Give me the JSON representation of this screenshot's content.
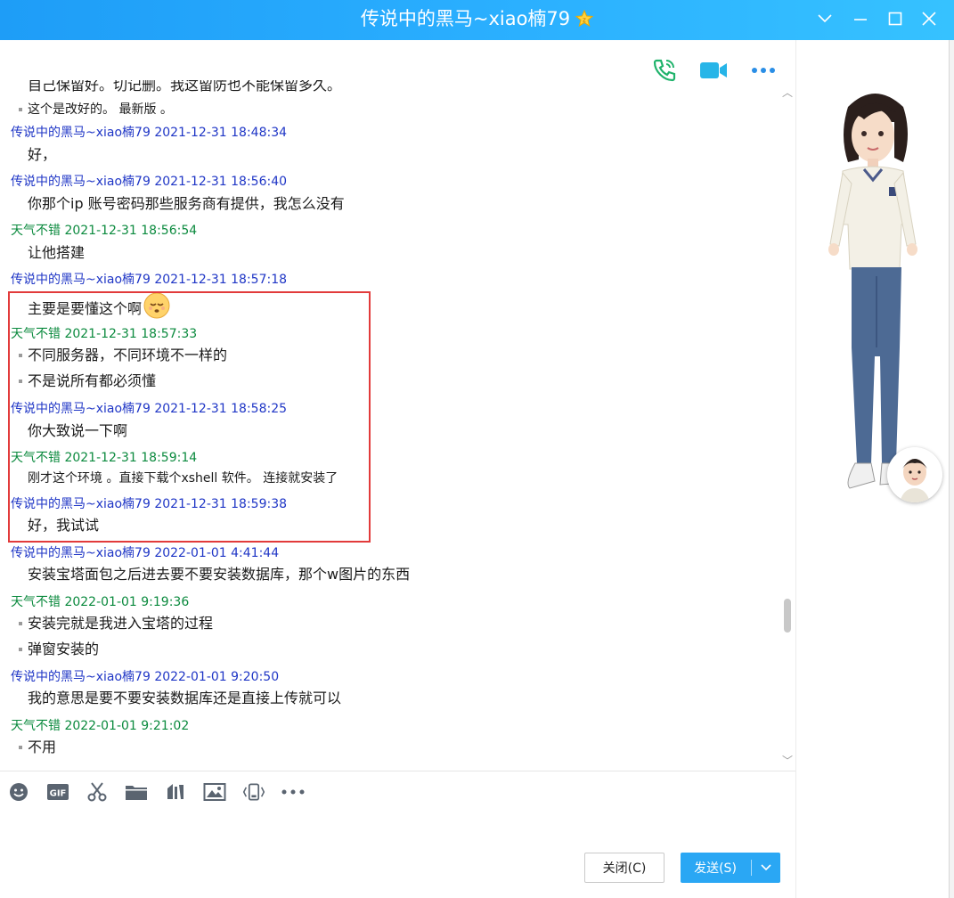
{
  "window": {
    "title": "传说中的黑马~xiao楠79",
    "controls": [
      "minimize-to-tray",
      "minimize",
      "maximize",
      "close"
    ]
  },
  "chat_header_icons": [
    "phone-icon",
    "video-call-icon",
    "more-icon"
  ],
  "messages": [
    {
      "type": "content",
      "text": "自己保留好。切记删。我这留防也不能保留多久。",
      "partial": true
    },
    {
      "type": "content",
      "text": "这个是改好的。 最新版 。",
      "bullet": true,
      "small": true
    },
    {
      "type": "sender",
      "who": "传说中的黑马~xiao楠79",
      "time": "2021-12-31 18:48:34",
      "color": "blue"
    },
    {
      "type": "content",
      "text": "好，"
    },
    {
      "type": "sender",
      "who": "传说中的黑马~xiao楠79",
      "time": "2021-12-31 18:56:40",
      "color": "blue"
    },
    {
      "type": "content",
      "text": "你那个ip 账号密码那些服务商有提供，我怎么没有"
    },
    {
      "type": "sender",
      "who": "天气不错",
      "time": "2021-12-31 18:56:54",
      "color": "green"
    },
    {
      "type": "content",
      "text": "让他搭建"
    },
    {
      "type": "sender",
      "who": "传说中的黑马~xiao楠79",
      "time": "2021-12-31 18:57:18",
      "color": "blue"
    },
    {
      "type": "content",
      "text": "主要是要懂这个啊",
      "emoji": "sigh-face"
    },
    {
      "type": "sender",
      "who": "天气不错",
      "time": "2021-12-31 18:57:33",
      "color": "green"
    },
    {
      "type": "content",
      "text": "不同服务器，不同环境不一样的",
      "bullet": true
    },
    {
      "type": "content",
      "text": "不是说所有都必须懂",
      "bullet": true
    },
    {
      "type": "sender",
      "who": "传说中的黑马~xiao楠79",
      "time": "2021-12-31 18:58:25",
      "color": "blue"
    },
    {
      "type": "content",
      "text": "你大致说一下啊"
    },
    {
      "type": "sender",
      "who": "天气不错",
      "time": "2021-12-31 18:59:14",
      "color": "green"
    },
    {
      "type": "content",
      "text": "刚才这个环境 。直接下载个xshell 软件。 连接就安装了",
      "small": true
    },
    {
      "type": "sender",
      "who": "传说中的黑马~xiao楠79",
      "time": "2021-12-31 18:59:38",
      "color": "blue"
    },
    {
      "type": "content",
      "text": "好，我试试"
    },
    {
      "type": "sender",
      "who": "传说中的黑马~xiao楠79",
      "time": "2022-01-01 4:41:44",
      "color": "blue"
    },
    {
      "type": "content",
      "text": "安装宝塔面包之后进去要不要安装数据库，那个w图片的东西"
    },
    {
      "type": "sender",
      "who": "天气不错",
      "time": "2022-01-01 9:19:36",
      "color": "green"
    },
    {
      "type": "content",
      "text": "安装完就是我进入宝塔的过程",
      "bullet": true
    },
    {
      "type": "content",
      "text": "弹窗安装的",
      "bullet": true
    },
    {
      "type": "sender",
      "who": "传说中的黑马~xiao楠79",
      "time": "2022-01-01 9:20:50",
      "color": "blue"
    },
    {
      "type": "content",
      "text": "我的意思是要不要安装数据库还是直接上传就可以"
    },
    {
      "type": "sender",
      "who": "天气不错",
      "time": "2022-01-01 9:21:02",
      "color": "green"
    },
    {
      "type": "content",
      "text": "不用",
      "bullet": true
    }
  ],
  "input_toolbar": [
    "emoji-icon",
    "gif-icon",
    "scissors-icon",
    "folder-icon",
    "music-icon",
    "image-icon",
    "shake-icon",
    "more-icon"
  ],
  "input_toolbar_right": [
    "expand-icon",
    "history-clock-icon"
  ],
  "buttons": {
    "close_label": "关闭(C)",
    "send_label": "发送(S)"
  },
  "colors": {
    "titlebar": "#2aa7f4",
    "sender_blue": "#1f36c6",
    "sender_green": "#0b8a3e",
    "highlight_border": "#e23b3b",
    "send_button": "#2aa7f4"
  }
}
